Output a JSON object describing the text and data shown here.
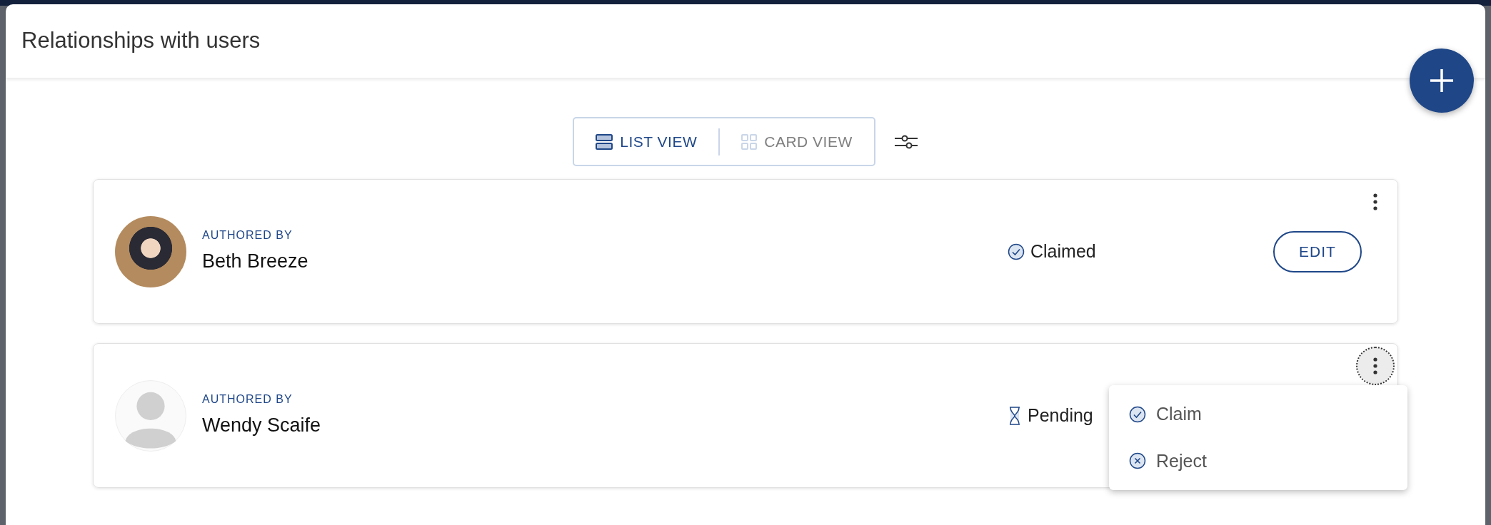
{
  "dialog": {
    "title": "Relationships with users"
  },
  "view_toggle": [
    {
      "kind": "list",
      "label": "LIST VIEW",
      "selected": true
    },
    {
      "kind": "card",
      "label": "CARD VIEW",
      "selected": false
    }
  ],
  "relationships": [
    {
      "kind": "photo",
      "role": "AUTHORED BY",
      "name": "Beth Breeze",
      "status": {
        "kind": "claimed",
        "text": "Claimed"
      },
      "edit_label": "EDIT",
      "menu_open": false
    },
    {
      "kind": "default",
      "role": "AUTHORED BY",
      "name": "Wendy Scaife",
      "status": {
        "kind": "pending",
        "text": "Pending"
      },
      "menu_open": true,
      "menu": [
        {
          "kind": "claim",
          "label": "Claim"
        },
        {
          "kind": "reject",
          "label": "Reject"
        }
      ]
    }
  ]
}
